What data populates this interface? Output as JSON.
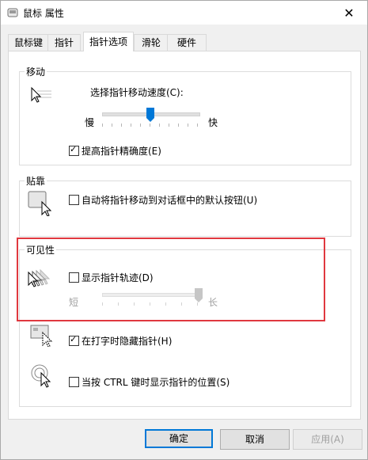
{
  "window": {
    "title": "鼠标 属性"
  },
  "tabs": [
    "鼠标键",
    "指针",
    "指针选项",
    "滑轮",
    "硬件"
  ],
  "motion": {
    "group_label": "移动",
    "speed_label": "选择指针移动速度(C):",
    "slow": "慢",
    "fast": "快",
    "speed_value": 0.5,
    "precision_label": "提高指针精确度(E)",
    "precision_checked": true
  },
  "snap": {
    "group_label": "贴靠",
    "label": "自动将指针移动到对话框中的默认按钮(U)",
    "checked": false
  },
  "visibility": {
    "group_label": "可见性",
    "trails_label": "显示指针轨迹(D)",
    "trails_checked": false,
    "short": "短",
    "long": "长",
    "trails_value": 1.0,
    "hide_label": "在打字时隐藏指针(H)",
    "hide_checked": true,
    "ctrl_label": "当按 CTRL 键时显示指针的位置(S)",
    "ctrl_checked": false
  },
  "buttons": {
    "ok": "确定",
    "cancel": "取消",
    "apply": "应用(A)"
  }
}
